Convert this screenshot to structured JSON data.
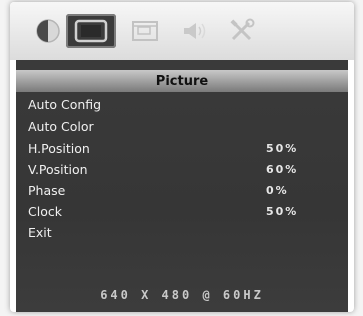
{
  "menu": {
    "title": "Picture",
    "items": [
      {
        "label": "Auto Config",
        "value": ""
      },
      {
        "label": "Auto Color",
        "value": ""
      },
      {
        "label": "H.Position",
        "value": "50%"
      },
      {
        "label": "V.Position",
        "value": "60%"
      },
      {
        "label": "Phase",
        "value": "0%"
      },
      {
        "label": "Clock",
        "value": "50%"
      },
      {
        "label": "Exit",
        "value": ""
      }
    ]
  },
  "tabs": [
    {
      "icon": "contrast-icon",
      "active": false
    },
    {
      "icon": "picture-icon",
      "active": true
    },
    {
      "icon": "osd-setup-icon",
      "active": false
    },
    {
      "icon": "speaker-icon",
      "active": false
    },
    {
      "icon": "tools-icon",
      "active": false
    }
  ],
  "status": {
    "resolution": "640 X 480 @ 60HZ"
  },
  "colors": {
    "panel": "#393939",
    "title_bar": "#a6a6a6",
    "text": "#f0f0f0"
  }
}
